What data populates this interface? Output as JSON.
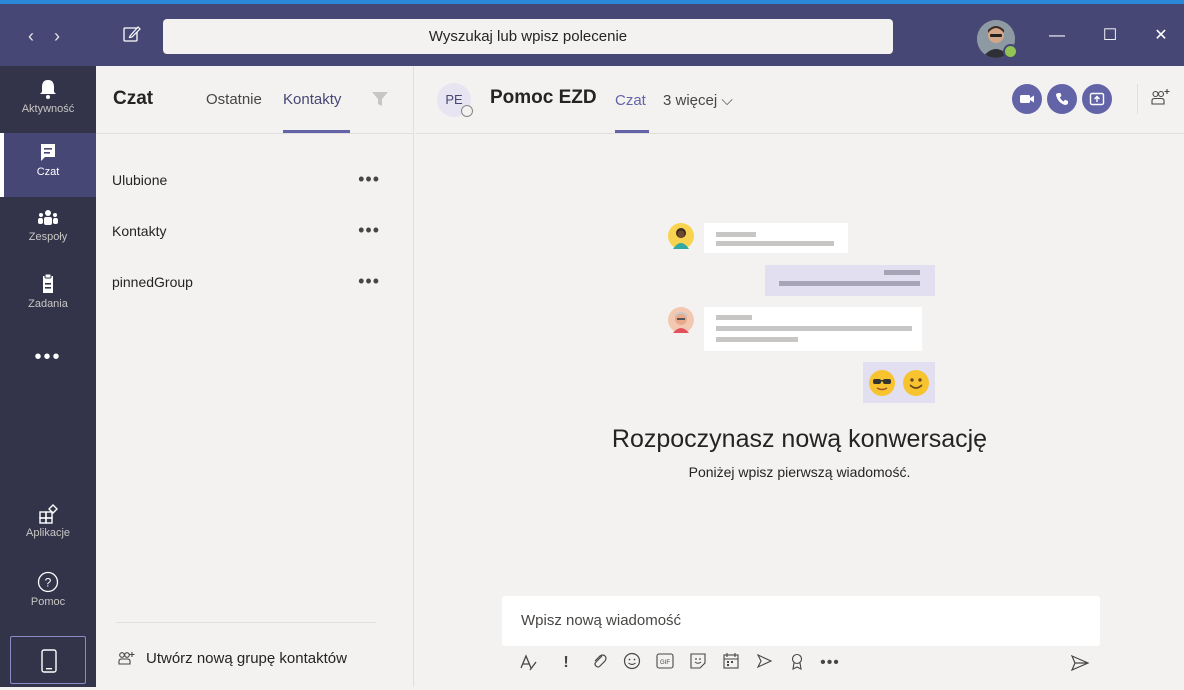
{
  "titlebar": {
    "search_placeholder": "Wyszukaj lub wpisz polecenie",
    "back_icon": "chevron-left-icon",
    "forward_icon": "chevron-right-icon",
    "compose_icon": "new-chat-icon",
    "minimize": "—",
    "maximize": "☐",
    "close": "✕"
  },
  "rail": {
    "items": [
      {
        "label": "Aktywność",
        "icon": "bell-icon"
      },
      {
        "label": "Czat",
        "icon": "chat-icon"
      },
      {
        "label": "Zespoły",
        "icon": "teams-icon"
      },
      {
        "label": "Zadania",
        "icon": "clipboard-icon"
      }
    ],
    "more": "•••",
    "bottom": [
      {
        "label": "Aplikacje",
        "icon": "apps-icon"
      },
      {
        "label": "Pomoc",
        "icon": "help-icon"
      }
    ]
  },
  "chatlist": {
    "title": "Czat",
    "tabs": [
      "Ostatnie",
      "Kontakty"
    ],
    "active_tab": "Kontakty",
    "groups": [
      {
        "label": "Ulubione"
      },
      {
        "label": "Kontakty"
      },
      {
        "label": "pinnedGroup"
      }
    ],
    "more_dots": "•••",
    "new_group": "Utwórz nową grupę kontaktów"
  },
  "chat": {
    "initials": "PE",
    "name": "Pomoc EZD",
    "tab": "Czat",
    "more_tabs": "3 więcej ⌵",
    "empty_title": "Rozpoczynasz nową konwersację",
    "empty_subtitle": "Poniżej wpisz pierwszą wiadomość.",
    "compose_placeholder": "Wpisz nową wiadomość"
  },
  "colors": {
    "titlebar": "#464775",
    "rail": "#33344a",
    "accent": "#6264a7",
    "background": "#f3f2f1"
  }
}
